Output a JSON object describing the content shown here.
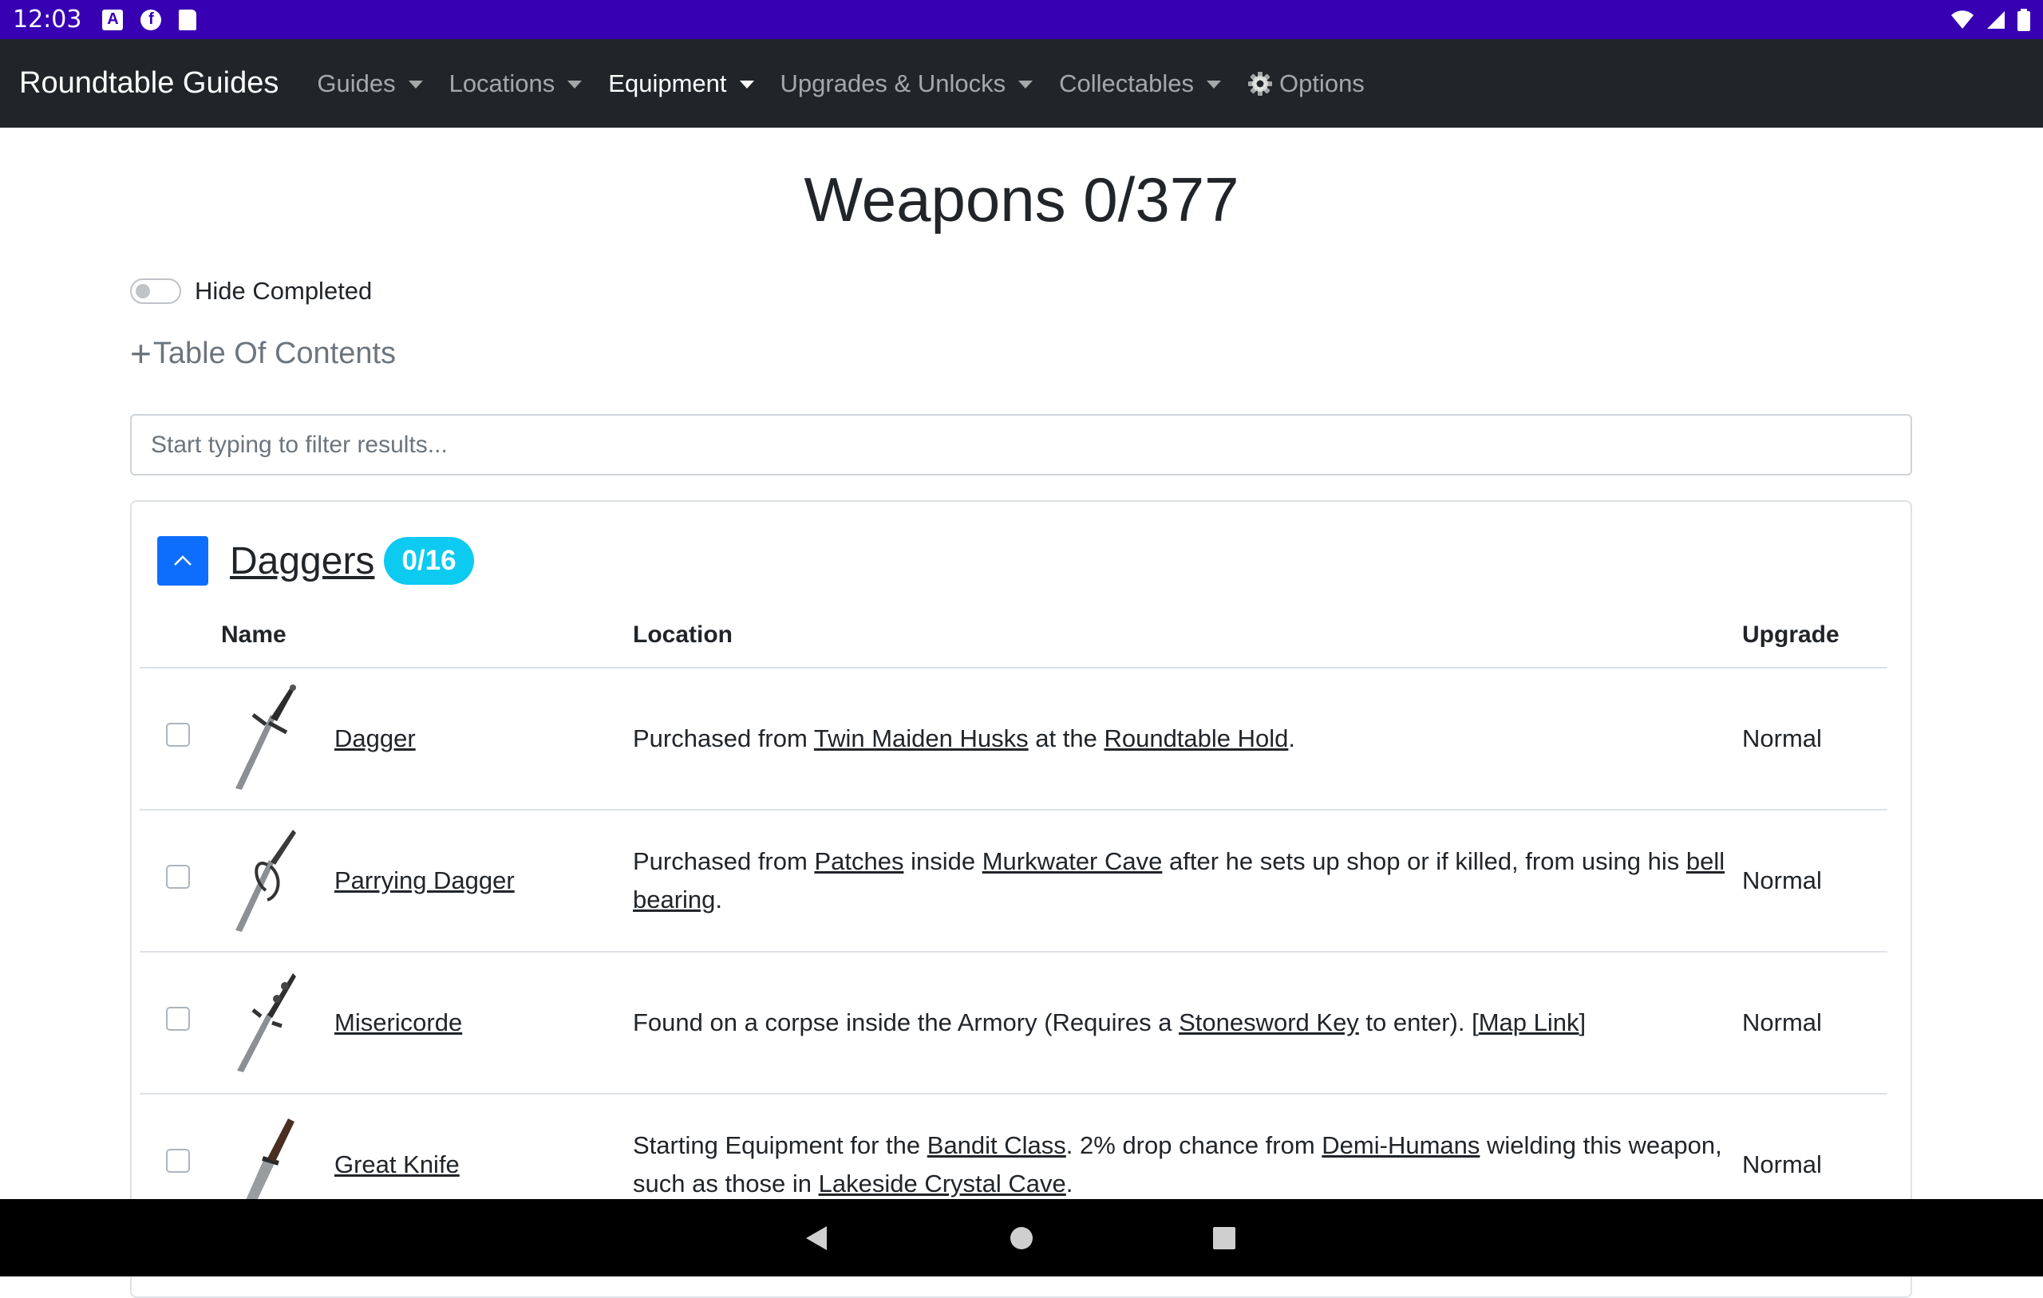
{
  "status_bar": {
    "time": "12:03",
    "icons": [
      "a-notification-icon",
      "f-notification-icon",
      "sd-card-icon"
    ],
    "right_icons": [
      "wifi-icon",
      "signal-icon",
      "battery-icon"
    ]
  },
  "navbar": {
    "brand": "Roundtable Guides",
    "items": [
      {
        "label": "Guides",
        "dropdown": true
      },
      {
        "label": "Locations",
        "dropdown": true
      },
      {
        "label": "Equipment",
        "dropdown": true,
        "active": true
      },
      {
        "label": "Upgrades & Unlocks",
        "dropdown": true
      },
      {
        "label": "Collectables",
        "dropdown": true
      },
      {
        "label": "Options",
        "icon": "gear-icon"
      }
    ]
  },
  "page": {
    "title": "Weapons 0/377",
    "hide_completed_label": "Hide Completed",
    "toc_label": "Table Of Contents",
    "filter_placeholder": "Start typing to filter results..."
  },
  "section": {
    "title": "Daggers",
    "badge": "0/16",
    "columns": {
      "name": "Name",
      "location": "Location",
      "upgrade": "Upgrade"
    },
    "rows": [
      {
        "name": "Dagger",
        "upgrade": "Normal",
        "location": [
          {
            "t": "Purchased from "
          },
          {
            "t": "Twin Maiden Husks",
            "link": true
          },
          {
            "t": " at the "
          },
          {
            "t": "Roundtable Hold",
            "link": true
          },
          {
            "t": "."
          }
        ]
      },
      {
        "name": "Parrying Dagger",
        "upgrade": "Normal",
        "location": [
          {
            "t": "Purchased from "
          },
          {
            "t": "Patches",
            "link": true
          },
          {
            "t": " inside "
          },
          {
            "t": "Murkwater Cave",
            "link": true
          },
          {
            "t": " after he sets up shop or if killed, from using his "
          },
          {
            "t": "bell bearing",
            "link": true
          },
          {
            "t": "."
          }
        ]
      },
      {
        "name": "Misericorde",
        "upgrade": "Normal",
        "location": [
          {
            "t": "Found on a corpse inside the Armory (Requires a "
          },
          {
            "t": "Stonesword Key",
            "link": true
          },
          {
            "t": " to enter). ["
          },
          {
            "t": "Map Link",
            "link": true
          },
          {
            "t": "]"
          }
        ]
      },
      {
        "name": "Great Knife",
        "upgrade": "Normal",
        "location": [
          {
            "t": "Starting Equipment for the "
          },
          {
            "t": "Bandit Class",
            "link": true
          },
          {
            "t": ". 2% drop chance from "
          },
          {
            "t": "Demi-Humans",
            "link": true
          },
          {
            "t": " wielding this weapon, such as those in "
          },
          {
            "t": "Lakeside Crystal Cave",
            "link": true
          },
          {
            "t": "."
          }
        ]
      }
    ]
  },
  "colors": {
    "status_bar": "#3700b3",
    "navbar": "#212529",
    "primary": "#0d6efd",
    "info_badge": "#0dcaf0",
    "nav_bar_bottom": "#000000"
  }
}
